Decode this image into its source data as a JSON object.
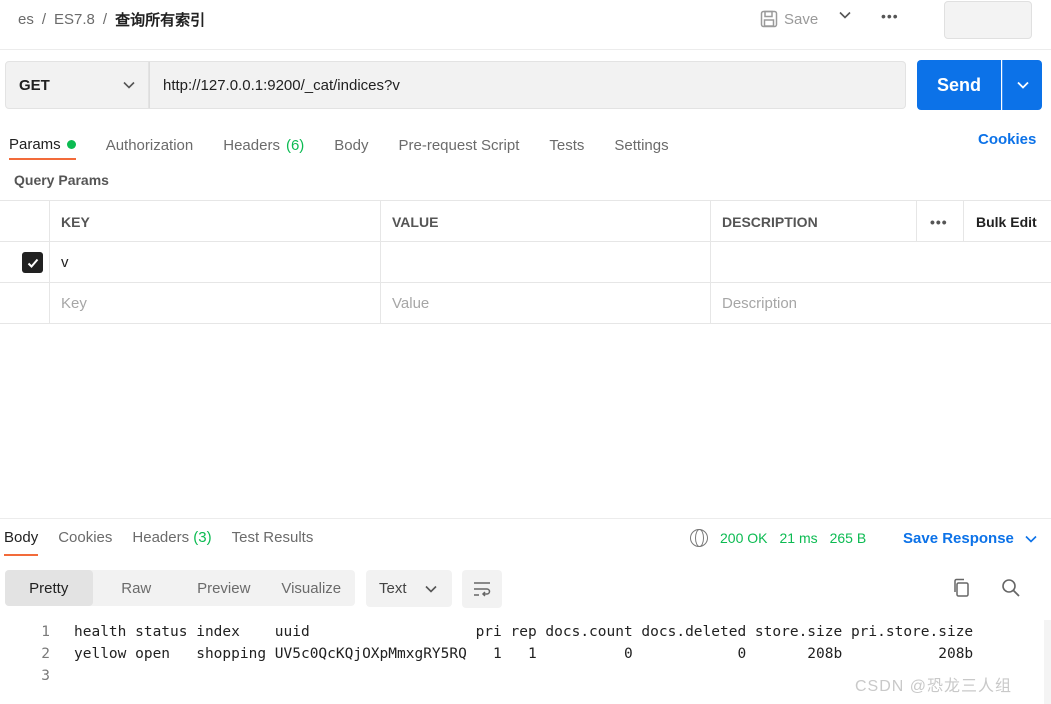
{
  "breadcrumb": {
    "workspace": "es",
    "collection": "ES7.8",
    "request": "查询所有索引",
    "separator": "/"
  },
  "toolbar": {
    "save_label": "Save",
    "more": "•••"
  },
  "request": {
    "method": "GET",
    "url": "http://127.0.0.1:9200/_cat/indices?v",
    "send_label": "Send"
  },
  "tabs": {
    "params": "Params",
    "authorization": "Authorization",
    "headers": "Headers",
    "headers_count": "(6)",
    "body": "Body",
    "prerequest": "Pre-request Script",
    "tests": "Tests",
    "settings": "Settings",
    "cookies": "Cookies"
  },
  "query_params": {
    "label": "Query Params",
    "headers": {
      "key": "KEY",
      "value": "VALUE",
      "description": "DESCRIPTION",
      "more": "•••",
      "bulk_edit": "Bulk Edit"
    },
    "rows": [
      {
        "checked": true,
        "key": "v",
        "value": "",
        "description": ""
      }
    ],
    "placeholders": {
      "key": "Key",
      "value": "Value",
      "description": "Description"
    }
  },
  "response": {
    "tabs": {
      "body": "Body",
      "cookies": "Cookies",
      "headers": "Headers",
      "headers_count": "(3)",
      "test_results": "Test Results"
    },
    "status": "200 OK",
    "time": "21 ms",
    "size": "265 B",
    "save_response": "Save Response",
    "views": {
      "pretty": "Pretty",
      "raw": "Raw",
      "preview": "Preview",
      "visualize": "Visualize"
    },
    "format": "Text",
    "lines": [
      {
        "num": "1",
        "text": "health status index    uuid                   pri rep docs.count docs.deleted store.size pri.store.size"
      },
      {
        "num": "2",
        "text": "yellow open   shopping UV5c0QcKQjOXpMmxgRY5RQ   1   1          0            0       208b           208b"
      },
      {
        "num": "3",
        "text": ""
      }
    ]
  },
  "watermark": "CSDN @恐龙三人组",
  "colors": {
    "accent": "#0c72e8",
    "tab_underline": "#f26b3a",
    "success": "#0cbb52"
  }
}
